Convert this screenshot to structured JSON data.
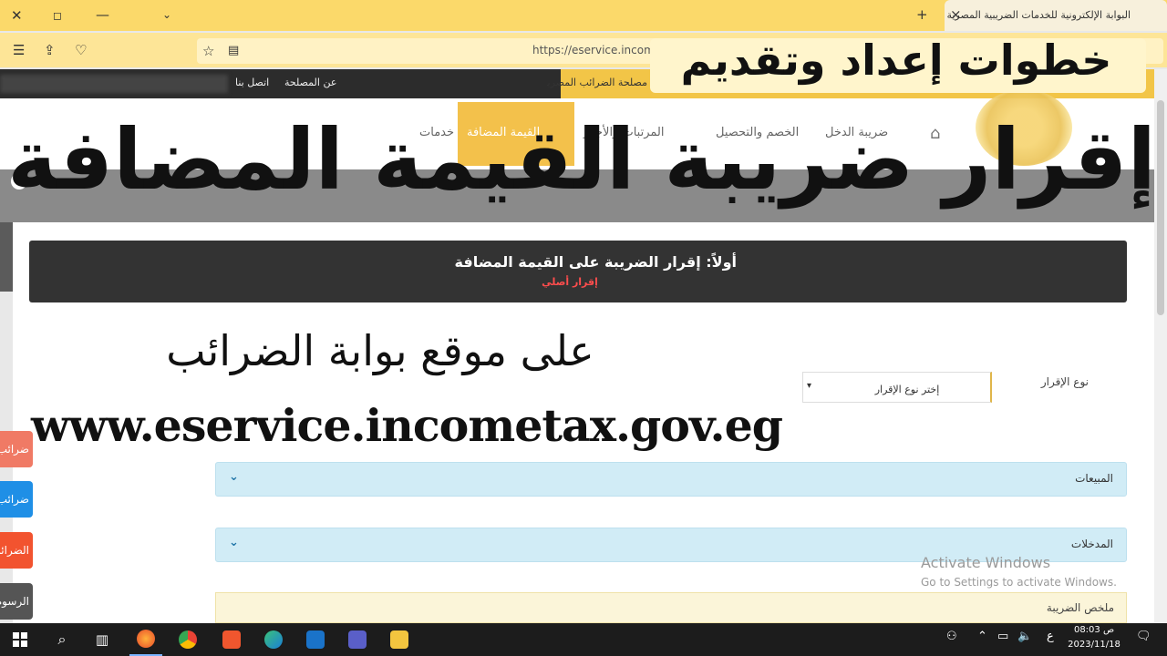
{
  "browser": {
    "tab_title": "البوابة الإلكترونية للخدمات الضريبية المصرية",
    "url": "https://eservice.incometax.gov.eg",
    "tab_close": "×",
    "new_tab": "+"
  },
  "site": {
    "top_links": [
      "عن المصلحة",
      "اتصل بنا"
    ],
    "top_right_text": "مصلحة الضرائب المصرية",
    "nav": [
      "الرئيسية",
      "ضريبة الدخل",
      "الخصم والتحصيل",
      "المرتبات والأجور",
      "القيمة المضافة",
      "خدمات"
    ]
  },
  "overlay": {
    "banner_top": "خطوات إعداد وتقديم",
    "big_title": "إقرار ضريبة القيمة المضافة",
    "subtitle": "على موقع بوابة الضرائب",
    "website": "www.eservice.incometax.gov.eg"
  },
  "form": {
    "section_title": "أولاً: إقرار الضريبة على القيمة المضافة",
    "section_subtitle": "إقرار أصلي",
    "declaration_type_label": "نوع الإقرار",
    "declaration_type_value": "إختر نوع الإقرار",
    "accordions": [
      "المبيعات",
      "المدخلات"
    ],
    "summary_label": "ملخص الضريبة"
  },
  "side_buttons": [
    {
      "label": "ضرائب",
      "color": "#f07a65"
    },
    {
      "label": "ضرائب",
      "color": "#1f8fe6"
    },
    {
      "label": "الضرائب",
      "color": "#f2532f"
    },
    {
      "label": "الرسوم",
      "color": "#555555"
    }
  ],
  "watermark": {
    "line1": "Activate Windows",
    "line2": "Go to Settings to activate Windows."
  },
  "taskbar": {
    "time": "08:03 ص",
    "date": "2023/11/18",
    "lang": "ع"
  }
}
